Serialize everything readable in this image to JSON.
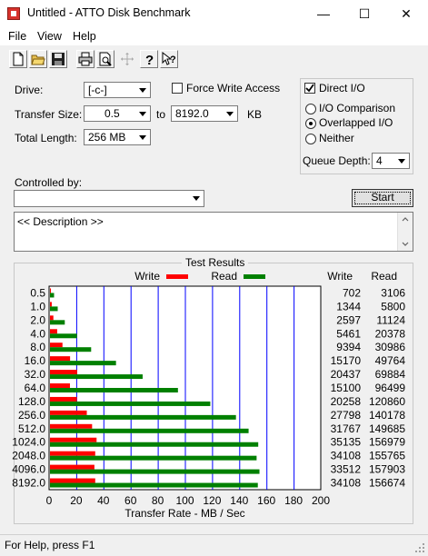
{
  "window": {
    "title": "Untitled - ATTO Disk Benchmark",
    "minimize": "—",
    "maximize": "☐",
    "close": "✕"
  },
  "menu": [
    "File",
    "View",
    "Help"
  ],
  "toolbar": {
    "icons": [
      "new-file-icon",
      "open-folder-icon",
      "save-disk-icon",
      "print-icon",
      "print-preview-icon",
      "move-arrows-icon",
      "help-icon",
      "context-help-icon"
    ]
  },
  "settings": {
    "drive_label": "Drive:",
    "drive_value": "[-c-]",
    "force_write_label": "Force Write Access",
    "force_write_checked": false,
    "direct_io_label": "Direct I/O",
    "direct_io_checked": true,
    "transfer_size_label": "Transfer Size:",
    "transfer_from": "0.5",
    "to_label": "to",
    "transfer_to": "8192.0",
    "kb_label": "KB",
    "total_length_label": "Total Length:",
    "total_length_value": "256 MB",
    "io_comparison_label": "I/O Comparison",
    "overlapped_io_label": "Overlapped I/O",
    "neither_label": "Neither",
    "queue_depth_label": "Queue Depth:",
    "queue_depth_value": "4",
    "controlled_by_label": "Controlled by:",
    "controlled_by_value": "",
    "start_label": "Start",
    "description": "<< Description >>"
  },
  "results_title": "Test Results",
  "status": "For Help, press F1",
  "chart_data": {
    "type": "bar",
    "orientation": "horizontal",
    "xlabel": "Transfer Rate - MB / Sec",
    "xlim": [
      0,
      200
    ],
    "x_ticks": [
      "0",
      "20",
      "40",
      "60",
      "80",
      "100",
      "120",
      "140",
      "160",
      "180",
      "200"
    ],
    "legend": {
      "write": "Write",
      "read": "Read",
      "placement": "top"
    },
    "columns": {
      "write": "Write",
      "read": "Read"
    },
    "colors": {
      "write": "#ff0000",
      "read": "#008000",
      "grid": "#0000ff"
    },
    "categories": [
      "0.5",
      "1.0",
      "2.0",
      "4.0",
      "8.0",
      "16.0",
      "32.0",
      "64.0",
      "128.0",
      "256.0",
      "512.0",
      "1024.0",
      "2048.0",
      "4096.0",
      "8192.0"
    ],
    "write_kbps": [
      702,
      1344,
      2597,
      5461,
      9394,
      15170,
      20437,
      15100,
      20258,
      27798,
      31767,
      35135,
      34108,
      33512,
      34108
    ],
    "read_kbps": [
      3106,
      5800,
      11124,
      20378,
      30986,
      49764,
      69884,
      96499,
      120860,
      140178,
      149685,
      156979,
      155765,
      157903,
      156674
    ],
    "series": [
      {
        "name": "Write",
        "values": [
          0.7,
          1.3,
          2.5,
          5.3,
          9.2,
          14.8,
          20.0,
          14.7,
          19.8,
          27.1,
          31.0,
          34.3,
          33.3,
          32.7,
          33.3
        ]
      },
      {
        "name": "Read",
        "values": [
          3.0,
          5.7,
          10.9,
          19.9,
          30.3,
          48.6,
          68.2,
          94.2,
          118.0,
          136.9,
          146.2,
          153.3,
          152.1,
          154.2,
          153.0
        ]
      }
    ]
  }
}
